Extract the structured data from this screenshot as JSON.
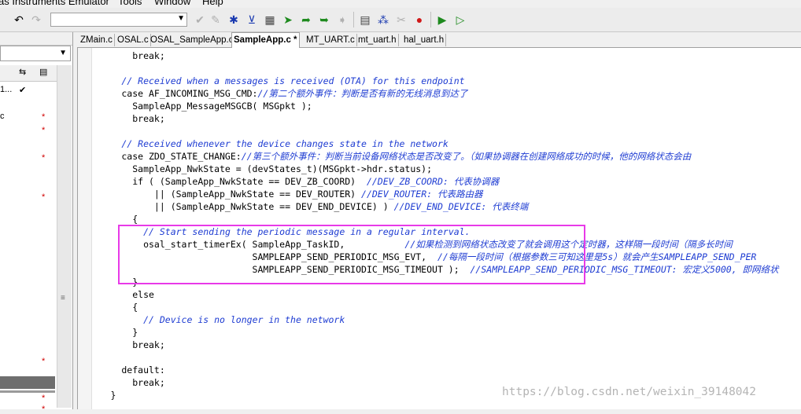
{
  "menubar": {
    "items": [
      "as Instruments Emulator",
      "Tools",
      "Window",
      "Help"
    ]
  },
  "toolbar": {
    "buttons": [
      {
        "name": "undo-icon",
        "glyph": "↶"
      },
      {
        "name": "redo-icon",
        "glyph": "↷"
      },
      {
        "name": "toggle-breakpoint-icon",
        "glyph": "✔"
      },
      {
        "name": "debug-icon",
        "glyph": "✎"
      },
      {
        "name": "go-to-cursor-icon",
        "glyph": "✱"
      },
      {
        "name": "filter-icon",
        "glyph": "⊻"
      },
      {
        "name": "compile-icon",
        "glyph": "▦"
      },
      {
        "name": "make-icon",
        "glyph": "➤"
      },
      {
        "name": "step-over-icon",
        "glyph": "➦"
      },
      {
        "name": "step-into-icon",
        "glyph": "➥"
      },
      {
        "name": "step-out-icon",
        "glyph": "➧"
      },
      {
        "name": "rebuild-icon",
        "glyph": "▤"
      },
      {
        "name": "network-icon",
        "glyph": "⁂"
      },
      {
        "name": "tools-icon",
        "glyph": "✂"
      },
      {
        "name": "stop-build-icon",
        "glyph": "●"
      },
      {
        "name": "download-debug-icon",
        "glyph": "▶"
      },
      {
        "name": "debug-without-download-icon",
        "glyph": "▷"
      }
    ],
    "combo_value": ""
  },
  "left_pane": {
    "combo_value": "",
    "col_icons": [
      "⇆",
      "▤"
    ],
    "rows": [
      {
        "text": "1...",
        "mark": "✔"
      },
      {
        "text": "c",
        "mark": ""
      }
    ],
    "stars": [
      "*",
      "*",
      "*",
      "*",
      "*",
      "*",
      "*"
    ]
  },
  "tabs": [
    {
      "label": "ZMain.c",
      "active": false
    },
    {
      "label": "OSAL.c",
      "active": false
    },
    {
      "label": "OSAL_SampleApp.c",
      "active": false
    },
    {
      "label": "SampleApp.c *",
      "active": true
    },
    {
      "label": "MT_UART.c",
      "active": false
    },
    {
      "label": "mt_uart.h",
      "active": false
    },
    {
      "label": "hal_uart.h",
      "active": false
    }
  ],
  "code_lines": [
    {
      "code": "          break;",
      "comment": ""
    },
    {
      "code": "",
      "comment": ""
    },
    {
      "code": "        ",
      "comment": "// Received when a messages is received (OTA) for this endpoint"
    },
    {
      "code": "        case AF_INCOMING_MSG_CMD:",
      "comment": "//第二个额外事件：判断是否有新的无线消息到达了"
    },
    {
      "code": "          SampleApp_MessageMSGCB( MSGpkt );",
      "comment": ""
    },
    {
      "code": "          break;",
      "comment": ""
    },
    {
      "code": "",
      "comment": ""
    },
    {
      "code": "        ",
      "comment": "// Received whenever the device changes state in the network"
    },
    {
      "code": "        case ZDO_STATE_CHANGE:",
      "comment": "//第三个额外事件：判断当前设备网络状态是否改变了。（如果协调器在创建网络成功的时候，他的网络状态会由"
    },
    {
      "code": "          SampleApp_NwkState = (devStates_t)(MSGpkt->hdr.status);",
      "comment": ""
    },
    {
      "code": "          if ( (SampleApp_NwkState == DEV_ZB_COORD)  ",
      "comment": "//DEV_ZB_COORD: 代表协调器"
    },
    {
      "code": "              || (SampleApp_NwkState == DEV_ROUTER) ",
      "comment": "//DEV_ROUTER: 代表路由器"
    },
    {
      "code": "              || (SampleApp_NwkState == DEV_END_DEVICE) ) ",
      "comment": "//DEV_END_DEVICE: 代表终端"
    },
    {
      "code": "          {",
      "comment": ""
    },
    {
      "code": "            ",
      "comment": "// Start sending the periodic message in a regular interval."
    },
    {
      "code": "            osal_start_timerEx( SampleApp_TaskID,           ",
      "comment": "//如果检测到网络状态改变了就会调用这个定时器，这样隔一段时间（隔多长时间"
    },
    {
      "code": "                                SAMPLEAPP_SEND_PERIODIC_MSG_EVT,  ",
      "comment": "//每隔一段时间（根据参数三可知这里是5s）就会产生SAMPLEAPP_SEND_PER"
    },
    {
      "code": "                                SAMPLEAPP_SEND_PERIODIC_MSG_TIMEOUT );  ",
      "comment": "//SAMPLEAPP_SEND_PERIODIC_MSG_TIMEOUT: 宏定义5000, 即网络状"
    },
    {
      "code": "          }",
      "comment": ""
    },
    {
      "code": "          else",
      "comment": ""
    },
    {
      "code": "          {",
      "comment": ""
    },
    {
      "code": "            ",
      "comment": "// Device is no longer in the network"
    },
    {
      "code": "          }",
      "comment": ""
    },
    {
      "code": "          break;",
      "comment": ""
    },
    {
      "code": "",
      "comment": ""
    },
    {
      "code": "        default:",
      "comment": ""
    },
    {
      "code": "          break;",
      "comment": ""
    },
    {
      "code": "      }",
      "comment": ""
    }
  ],
  "watermark": "https://blog.csdn.net/weixin_39148042",
  "colors": {
    "comment": "#1e3cd2",
    "highlight_box": "#e83ae8",
    "star": "#d00000"
  }
}
